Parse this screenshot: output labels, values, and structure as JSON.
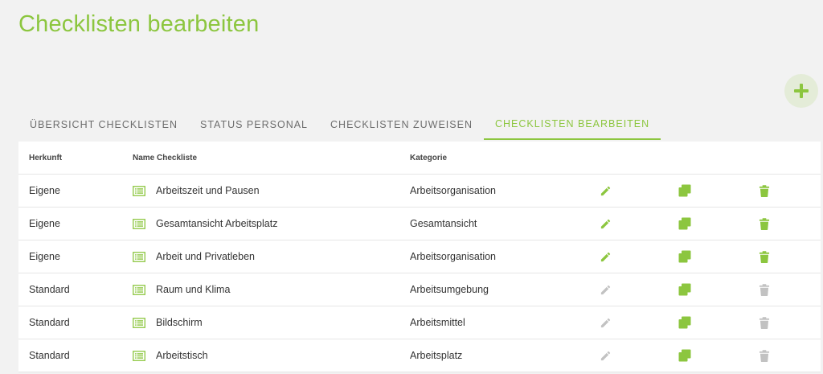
{
  "page": {
    "title": "Checklisten bearbeiten"
  },
  "colors": {
    "accent": "#8cc63f",
    "disabled": "#c2c2c2"
  },
  "tabs": [
    {
      "label": "ÜBERSICHT CHECKLISTEN",
      "active": false
    },
    {
      "label": "STATUS PERSONAL",
      "active": false
    },
    {
      "label": "CHECKLISTEN ZUWEISEN",
      "active": false
    },
    {
      "label": "CHECKLISTEN BEARBEITEN",
      "active": true
    }
  ],
  "fab": {
    "icon": "plus-icon"
  },
  "table": {
    "headers": {
      "herkunft": "Herkunft",
      "name": "Name Checkliste",
      "kategorie": "Kategorie"
    },
    "rows": [
      {
        "herkunft": "Eigene",
        "name": "Arbeitszeit und Pausen",
        "kategorie": "Arbeitsorganisation",
        "editable": true
      },
      {
        "herkunft": "Eigene",
        "name": "Gesamtansicht Arbeitsplatz",
        "kategorie": "Gesamtansicht",
        "editable": true
      },
      {
        "herkunft": "Eigene",
        "name": "Arbeit und Privatleben",
        "kategorie": "Arbeitsorganisation",
        "editable": true
      },
      {
        "herkunft": "Standard",
        "name": "Raum und Klima",
        "kategorie": "Arbeitsumgebung",
        "editable": false
      },
      {
        "herkunft": "Standard",
        "name": "Bildschirm",
        "kategorie": "Arbeitsmittel",
        "editable": false
      },
      {
        "herkunft": "Standard",
        "name": "Arbeitstisch",
        "kategorie": "Arbeitsplatz",
        "editable": false
      }
    ]
  }
}
